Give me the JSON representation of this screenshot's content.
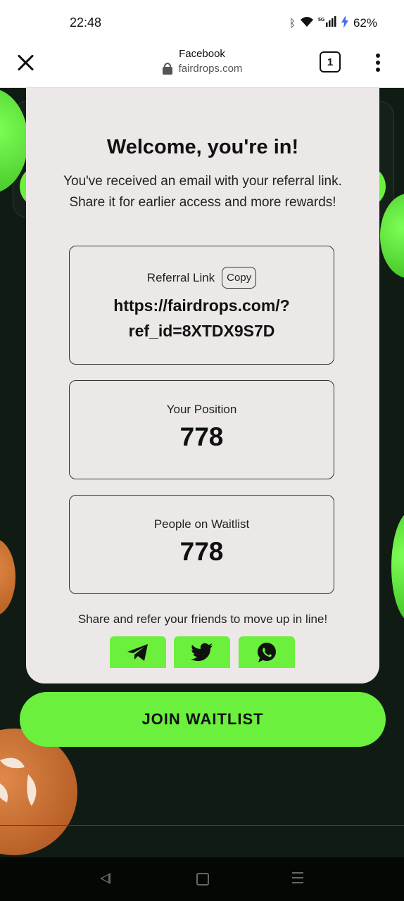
{
  "status_bar": {
    "time": "22:48",
    "battery": "62%",
    "icons": [
      "bluetooth-icon",
      "wifi-icon",
      "signal-5g-icon",
      "battery-charging-icon"
    ]
  },
  "browser": {
    "page_title": "Facebook",
    "url": "fairdrops.com",
    "tab_count": "1"
  },
  "modal": {
    "title": "Welcome, you're in!",
    "description": "You've received an email with your referral link. Share it for earlier access and more rewards!",
    "referral": {
      "label": "Referral Link",
      "copy_label": "Copy",
      "link_line1": "https://fairdrops.com/?",
      "link_line2": "ref_id=8XTDX9S7D"
    },
    "position": {
      "label": "Your Position",
      "value": "778"
    },
    "waitlist": {
      "label": "People on Waitlist",
      "value": "778"
    },
    "share_text": "Share and refer your friends to move up in line!",
    "share_buttons": [
      "telegram-icon",
      "twitter-icon",
      "whatsapp-icon"
    ]
  },
  "join_button": {
    "label": "JOIN WAITLIST"
  },
  "colors": {
    "accent_green": "#6af03d",
    "modal_bg": "#ece8e8",
    "page_bg": "#101b14"
  }
}
